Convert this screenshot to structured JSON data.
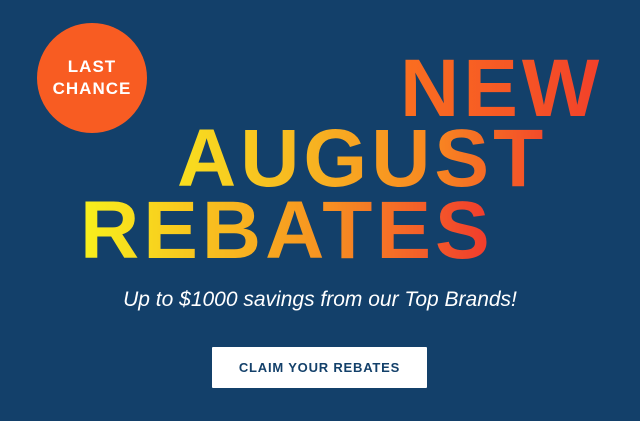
{
  "badge": {
    "line1": "LAST",
    "line2": "CHANCE"
  },
  "headline": {
    "line1": "NEW",
    "line2": "AUGUST",
    "line3": "REBATES"
  },
  "subtitle": "Up to $1000 savings from our Top Brands!",
  "cta": {
    "label": "CLAIM YOUR REBATES"
  },
  "colors": {
    "background": "#13406a",
    "badge": "#f85c22",
    "cta_background": "#ffffff",
    "cta_text": "#13406a",
    "text": "#ffffff"
  }
}
